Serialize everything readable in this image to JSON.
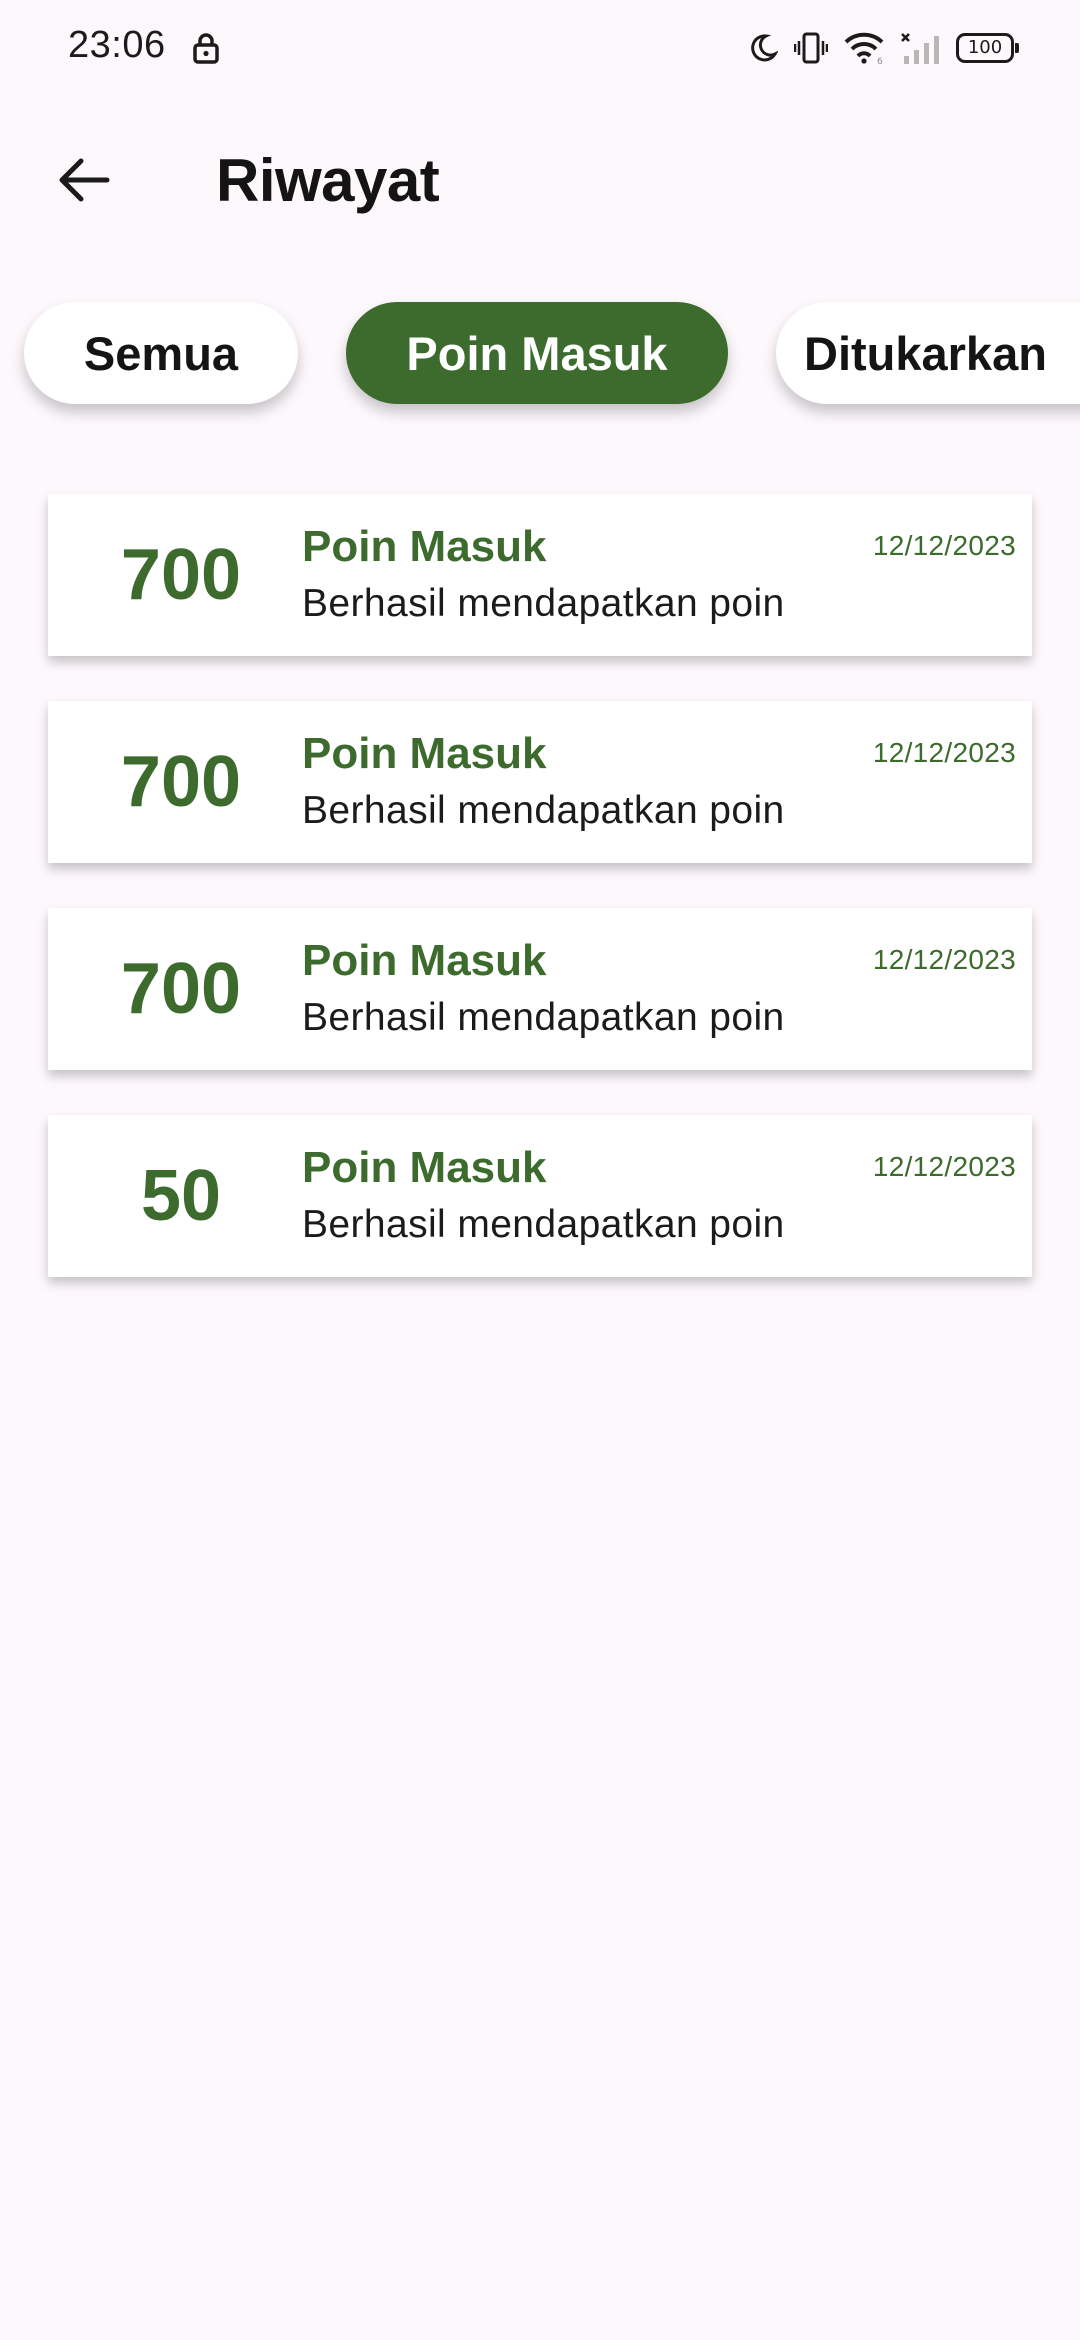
{
  "status_bar": {
    "time": "23:06",
    "battery": "100",
    "icons": [
      "lock-icon",
      "moon-icon",
      "vibrate-icon",
      "wifi-icon",
      "signal-off-icon",
      "battery-icon"
    ]
  },
  "app_bar": {
    "back_icon": "arrow-left-icon",
    "title": "Riwayat"
  },
  "filters": {
    "all": "Semua",
    "points_in": "Poin Masuk",
    "redeemed": "Ditukarkan",
    "selected": "Poin Masuk"
  },
  "history": [
    {
      "points": "700",
      "title": "Poin Masuk",
      "description": "Berhasil mendapatkan poin",
      "date": "12/12/2023"
    },
    {
      "points": "700",
      "title": "Poin Masuk",
      "description": "Berhasil mendapatkan poin",
      "date": "12/12/2023"
    },
    {
      "points": "700",
      "title": "Poin Masuk",
      "description": "Berhasil mendapatkan poin",
      "date": "12/12/2023"
    },
    {
      "points": "50",
      "title": "Poin Masuk",
      "description": "Berhasil mendapatkan poin",
      "date": "12/12/2023"
    }
  ],
  "colors": {
    "accent": "#3c6b2d",
    "background": "#fdf8fc",
    "card": "#ffffff",
    "text": "#141414"
  }
}
